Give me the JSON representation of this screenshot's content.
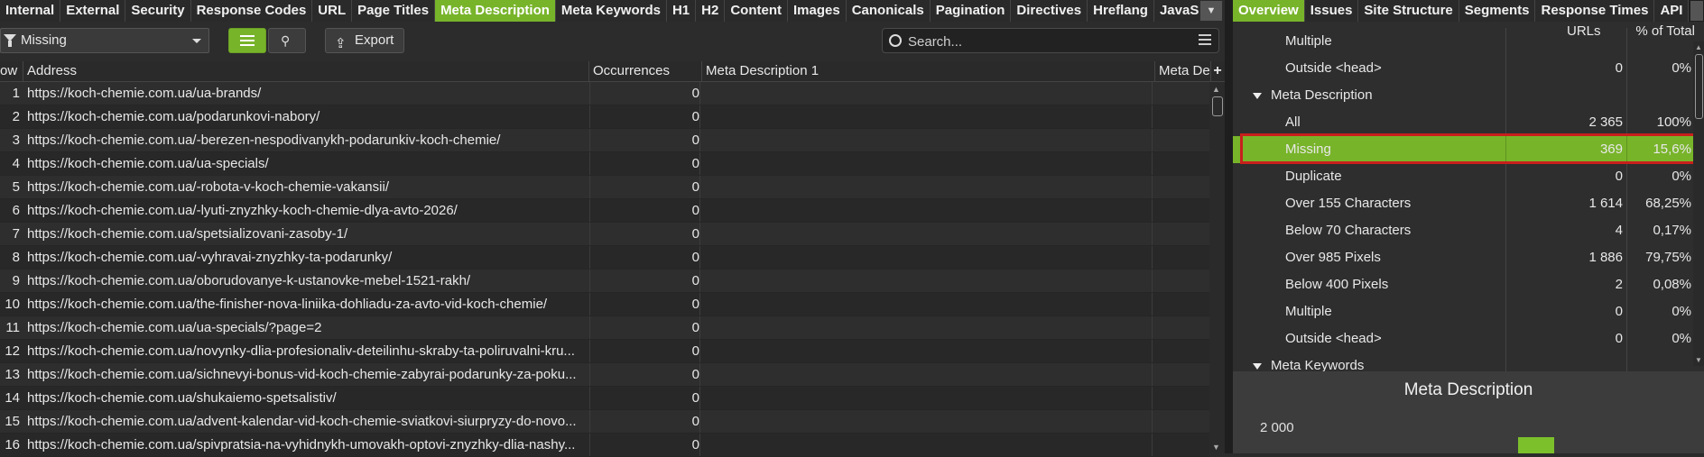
{
  "main_tabs": [
    "Internal",
    "External",
    "Security",
    "Response Codes",
    "URL",
    "Page Titles",
    "Meta Description",
    "Meta Keywords",
    "H1",
    "H2",
    "Content",
    "Images",
    "Canonicals",
    "Pagination",
    "Directives",
    "Hreflang",
    "JavaScr"
  ],
  "active_tab": "Meta Description",
  "toolbar": {
    "filter_value": "Missing",
    "export_label": "Export",
    "search_placeholder": "Search..."
  },
  "grid": {
    "columns": [
      "ow",
      "Address",
      "Occurrences",
      "Meta Description 1",
      "Meta Des"
    ],
    "rows": [
      {
        "n": "1",
        "address": "https://koch-chemie.com.ua/ua-brands/",
        "occ": "0"
      },
      {
        "n": "2",
        "address": "https://koch-chemie.com.ua/podarunkovi-nabory/",
        "occ": "0"
      },
      {
        "n": "3",
        "address": "https://koch-chemie.com.ua/-berezen-nespodivanykh-podarunkiv-koch-chemie/",
        "occ": "0"
      },
      {
        "n": "4",
        "address": "https://koch-chemie.com.ua/ua-specials/",
        "occ": "0"
      },
      {
        "n": "5",
        "address": "https://koch-chemie.com.ua/-robota-v-koch-chemie-vakansii/",
        "occ": "0"
      },
      {
        "n": "6",
        "address": "https://koch-chemie.com.ua/-lyuti-znyzhky-koch-chemie-dlya-avto-2026/",
        "occ": "0"
      },
      {
        "n": "7",
        "address": "https://koch-chemie.com.ua/spetsializovani-zasoby-1/",
        "occ": "0"
      },
      {
        "n": "8",
        "address": "https://koch-chemie.com.ua/-vyhravai-znyzhky-ta-podarunky/",
        "occ": "0"
      },
      {
        "n": "9",
        "address": "https://koch-chemie.com.ua/oborudovanye-k-ustanovke-mebel-1521-rakh/",
        "occ": "0"
      },
      {
        "n": "10",
        "address": "https://koch-chemie.com.ua/the-finisher-nova-liniika-dohliadu-za-avto-vid-koch-chemie/",
        "occ": "0"
      },
      {
        "n": "11",
        "address": "https://koch-chemie.com.ua/ua-specials/?page=2",
        "occ": "0"
      },
      {
        "n": "12",
        "address": "https://koch-chemie.com.ua/novynky-dlia-profesionaliv-deteilinhu-skraby-ta-poliruvalni-kru...",
        "occ": "0"
      },
      {
        "n": "13",
        "address": "https://koch-chemie.com.ua/sichnevyi-bonus-vid-koch-chemie-zabyrai-podarunky-za-poku...",
        "occ": "0"
      },
      {
        "n": "14",
        "address": "https://koch-chemie.com.ua/shukaiemo-spetsalistiv/",
        "occ": "0"
      },
      {
        "n": "15",
        "address": "https://koch-chemie.com.ua/advent-kalendar-vid-koch-chemie-sviatkovi-siurpryzy-do-novo...",
        "occ": "0"
      },
      {
        "n": "16",
        "address": "https://koch-chemie.com.ua/spivpratsia-na-vyhidnykh-umovakh-optovi-znyzhky-dlia-nashy...",
        "occ": "0"
      }
    ]
  },
  "right_tabs": [
    "Overview",
    "Issues",
    "Site Structure",
    "Segments",
    "Response Times",
    "API"
  ],
  "right_active_tab": "Overview",
  "summary": {
    "col_urls": "URLs",
    "col_pct": "% of Total",
    "top_rows": [
      {
        "name": "Multiple",
        "count": "",
        "pct": ""
      },
      {
        "name": "Outside <head>",
        "count": "0",
        "pct": "0%"
      }
    ],
    "group": "Meta Description",
    "rows": [
      {
        "name": "All",
        "count": "2 365",
        "pct": "100%"
      },
      {
        "name": "Missing",
        "count": "369",
        "pct": "15,6%"
      },
      {
        "name": "Duplicate",
        "count": "0",
        "pct": "0%"
      },
      {
        "name": "Over 155 Characters",
        "count": "1 614",
        "pct": "68,25%"
      },
      {
        "name": "Below 70 Characters",
        "count": "4",
        "pct": "0,17%"
      },
      {
        "name": "Over 985 Pixels",
        "count": "1 886",
        "pct": "79,75%"
      },
      {
        "name": "Below 400 Pixels",
        "count": "2",
        "pct": "0,08%"
      },
      {
        "name": "Multiple",
        "count": "0",
        "pct": "0%"
      },
      {
        "name": "Outside <head>",
        "count": "0",
        "pct": "0%"
      }
    ],
    "next_group": "Meta Keywords"
  },
  "chart": {
    "title": "Meta Description",
    "y_tick": "2 000"
  },
  "colors": {
    "accent": "#78b42a",
    "highlight_border": "#c8201c"
  }
}
